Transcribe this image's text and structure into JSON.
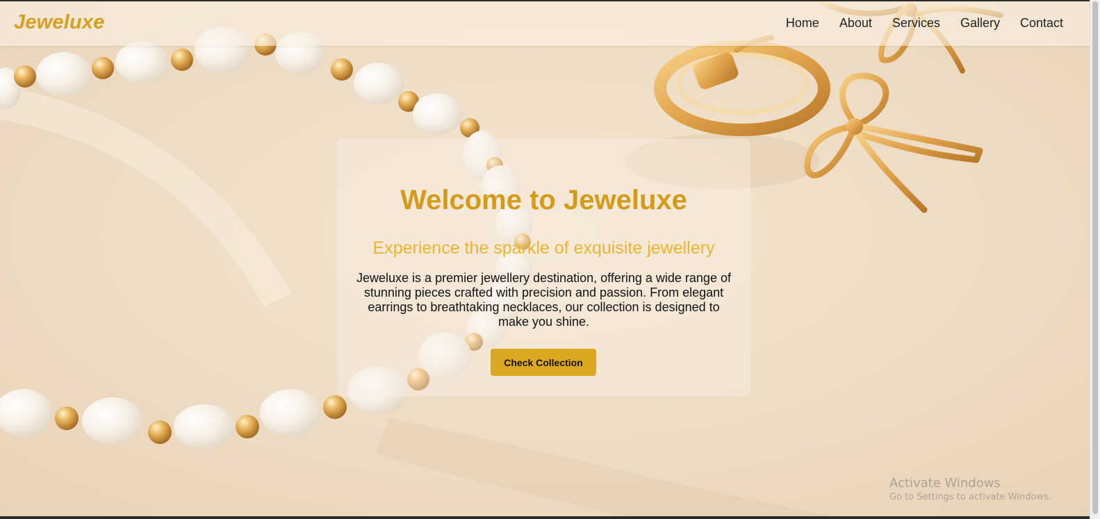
{
  "brand": {
    "name": "Jeweluxe"
  },
  "nav": {
    "items": [
      {
        "label": "Home"
      },
      {
        "label": "About"
      },
      {
        "label": "Services"
      },
      {
        "label": "Gallery"
      },
      {
        "label": "Contact"
      }
    ]
  },
  "hero": {
    "title": "Welcome to Jeweluxe",
    "subtitle": "Experience the sparkle of exquisite jewellery",
    "description": "Jeweluxe is a premier jewellery destination, offering a wide range of stunning pieces crafted with precision and passion. From elegant earrings to breathtaking necklaces, our collection is designed to make you shine.",
    "button_label": "Check Collection"
  },
  "watermark": {
    "title": "Activate Windows",
    "subtitle": "Go to Settings to activate Windows."
  },
  "colors": {
    "brand": "#d4a021",
    "title": "#d49b1a",
    "subtitle": "#ebb52d",
    "button": "#dba820",
    "background": "#f1e1cc"
  },
  "icons": {
    "background_image": "pearl-bracelet-gold-earrings-photo"
  }
}
